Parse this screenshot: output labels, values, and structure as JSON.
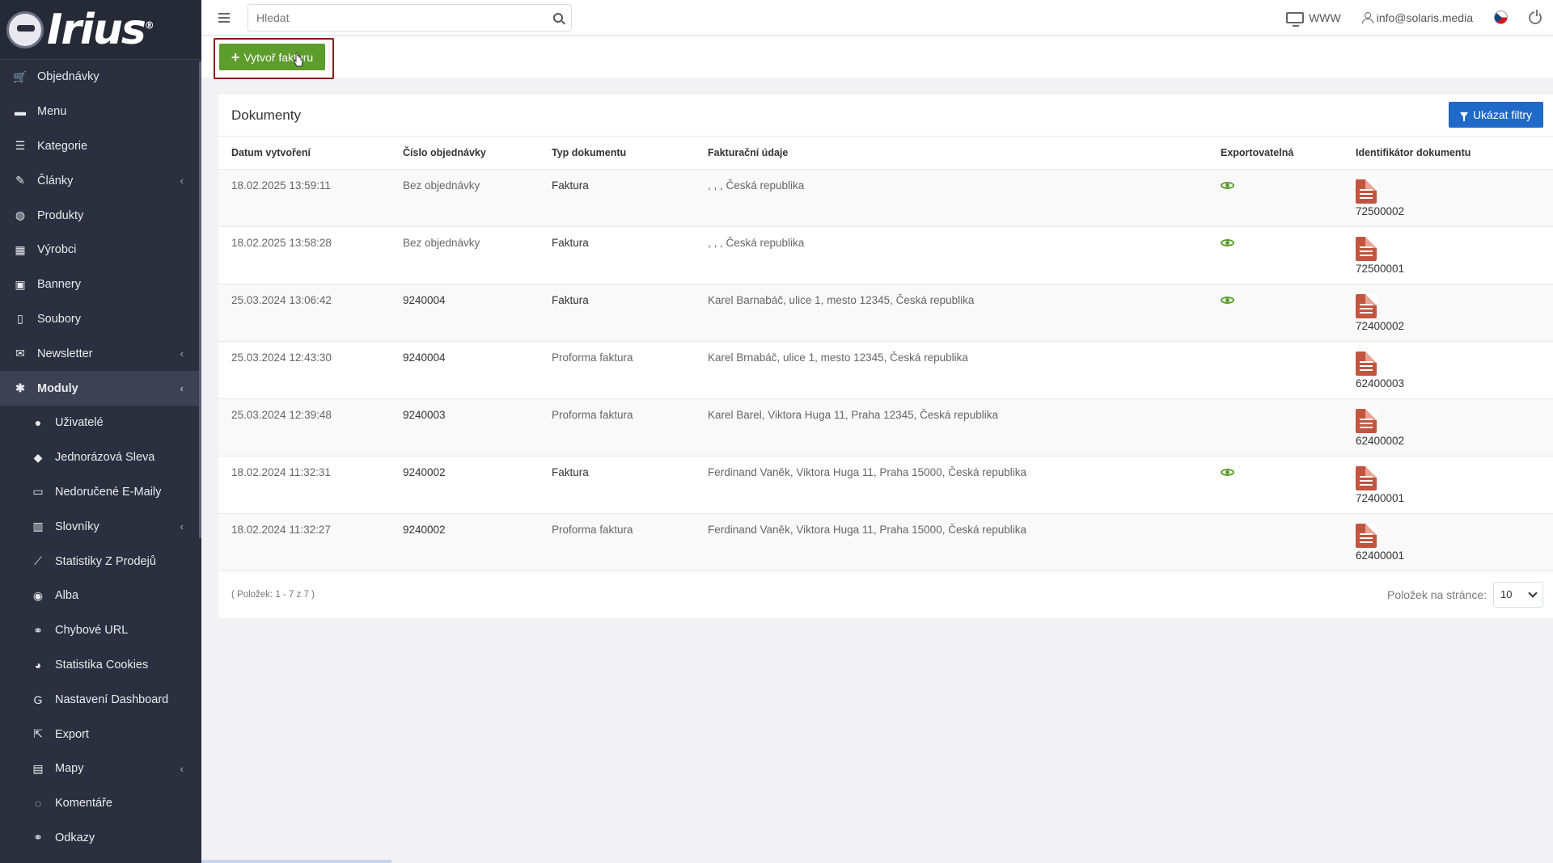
{
  "logo": {
    "text": "Irius",
    "reg": "®"
  },
  "sidebar": {
    "items": [
      {
        "label": "Objednávky",
        "icon": "cart-icon",
        "glyph": "🛒"
      },
      {
        "label": "Menu",
        "icon": "folder-icon",
        "glyph": "▬"
      },
      {
        "label": "Kategorie",
        "icon": "list-icon",
        "glyph": "☰"
      },
      {
        "label": "Články",
        "icon": "pen-icon",
        "glyph": "✎",
        "chevron": "‹"
      },
      {
        "label": "Produkty",
        "icon": "basketball-icon",
        "glyph": "◍"
      },
      {
        "label": "Výrobci",
        "icon": "building-icon",
        "glyph": "▦"
      },
      {
        "label": "Bannery",
        "icon": "image-icon",
        "glyph": "▣"
      },
      {
        "label": "Soubory",
        "icon": "file-icon",
        "glyph": "▯"
      },
      {
        "label": "Newsletter",
        "icon": "envelope-icon",
        "glyph": "✉",
        "chevron": "‹"
      },
      {
        "label": "Moduly",
        "icon": "puzzle-icon",
        "glyph": "✱",
        "chevron": "‹"
      },
      {
        "label": "Uživatelé",
        "icon": "user-icon",
        "glyph": "●"
      },
      {
        "label": "Jednorázová Sleva",
        "icon": "tag-icon",
        "glyph": "◆"
      },
      {
        "label": "Nedoručené E-Maily",
        "icon": "mail-icon",
        "glyph": "▭"
      },
      {
        "label": "Slovníky",
        "icon": "books-icon",
        "glyph": "▥",
        "chevron": "‹"
      },
      {
        "label": "Statistiky Z Prodejů",
        "icon": "chart-line-icon",
        "glyph": "⟋"
      },
      {
        "label": "Alba",
        "icon": "camera-icon",
        "glyph": "◉"
      },
      {
        "label": "Chybové URL",
        "icon": "link-icon",
        "glyph": "⚭"
      },
      {
        "label": "Statistika Cookies",
        "icon": "cookie-icon",
        "glyph": "◕"
      },
      {
        "label": "Nastavení Dashboard",
        "icon": "google-icon",
        "glyph": "G"
      },
      {
        "label": "Export",
        "icon": "export-icon",
        "glyph": "⇱"
      },
      {
        "label": "Mapy",
        "icon": "map-icon",
        "glyph": "▤",
        "chevron": "‹"
      },
      {
        "label": "Komentáře",
        "icon": "comments-icon",
        "glyph": "◌"
      },
      {
        "label": "Odkazy",
        "icon": "link-icon",
        "glyph": "⚭"
      }
    ]
  },
  "topbar": {
    "search_placeholder": "Hledat",
    "www_label": "WWW",
    "user_email": "info@solaris.media"
  },
  "actions": {
    "create_invoice_label": "Vytvoř fakturu"
  },
  "panel": {
    "title": "Dokumenty",
    "filter_button_label": "Ukázat filtry",
    "columns": [
      "Datum vytvoření",
      "Číslo objednávky",
      "Typ dokumentu",
      "Fakturační údaje",
      "Exportovatelná",
      "Identifikátor dokumentu"
    ],
    "rows": [
      {
        "date": "18.02.2025 13:59:11",
        "order": "Bez objednávky",
        "type": "Faktura",
        "billing": ", , , Česká republika",
        "exportable": true,
        "doc_id": "72500002"
      },
      {
        "date": "18.02.2025 13:58:28",
        "order": "Bez objednávky",
        "type": "Faktura",
        "billing": ", , , Česká republika",
        "exportable": true,
        "doc_id": "72500001"
      },
      {
        "date": "25.03.2024 13:06:42",
        "order": "9240004",
        "type": "Faktura",
        "billing": "Karel Barnabáč, ulice 1, mesto 12345, Česká republika",
        "exportable": true,
        "doc_id": "72400002"
      },
      {
        "date": "25.03.2024 12:43:30",
        "order": "9240004",
        "type": "Proforma faktura",
        "billing": "Karel Brnabáč, ulice 1, mesto 12345, Česká republika",
        "exportable": false,
        "doc_id": "62400003"
      },
      {
        "date": "25.03.2024 12:39:48",
        "order": "9240003",
        "type": "Proforma faktura",
        "billing": "Karel Barel, Viktora Huga 11, Praha 12345, Česká republika",
        "exportable": false,
        "doc_id": "62400002"
      },
      {
        "date": "18.02.2024 11:32:31",
        "order": "9240002",
        "type": "Faktura",
        "billing": "Ferdinand Vaněk, Viktora Huga 11, Praha 15000, Česká republika",
        "exportable": true,
        "doc_id": "72400001"
      },
      {
        "date": "18.02.2024 11:32:27",
        "order": "9240002",
        "type": "Proforma faktura",
        "billing": "Ferdinand Vaněk, Viktora Huga 11, Praha 15000, Česká republika",
        "exportable": false,
        "doc_id": "62400001"
      }
    ],
    "paging_info": "( Položek: 1 - 7 z 7 )",
    "per_page_label": "Položek na stránce:",
    "per_page_value": "10"
  },
  "colors": {
    "sidebar_bg": "#2b2f3e",
    "create_btn": "#5c9d2b",
    "filter_btn": "#1f69c9",
    "highlight_frame": "#8b1a1a"
  }
}
